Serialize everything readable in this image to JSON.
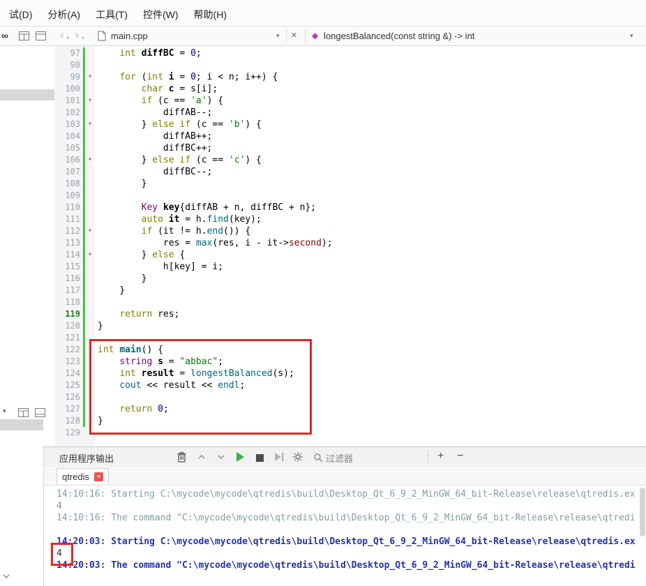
{
  "menubar": {
    "items": [
      "试(D)",
      "分析(A)",
      "工具(T)",
      "控件(W)",
      "帮助(H)"
    ]
  },
  "toolbar": {
    "file_tab": "main.cpp",
    "symbol": "longestBalanced(const string &) -> int"
  },
  "editor": {
    "lines": [
      {
        "n": 97,
        "bar": 1,
        "seg": [
          {
            "t": "    "
          },
          {
            "t": "int",
            "s": "kw"
          },
          {
            "t": " "
          },
          {
            "t": "diffBC",
            "s": "decl"
          },
          {
            "t": " = "
          },
          {
            "t": "0",
            "s": "num"
          },
          {
            "t": ";"
          }
        ]
      },
      {
        "n": 98,
        "bar": 1,
        "seg": []
      },
      {
        "n": 99,
        "bar": 1,
        "fold": 1,
        "seg": [
          {
            "t": "    "
          },
          {
            "t": "for",
            "s": "kw"
          },
          {
            "t": " ("
          },
          {
            "t": "int",
            "s": "kw"
          },
          {
            "t": " "
          },
          {
            "t": "i",
            "s": "decl"
          },
          {
            "t": " = "
          },
          {
            "t": "0",
            "s": "num"
          },
          {
            "t": "; i < n; i++) {"
          }
        ]
      },
      {
        "n": 100,
        "bar": 1,
        "seg": [
          {
            "t": "        "
          },
          {
            "t": "char",
            "s": "kw"
          },
          {
            "t": " "
          },
          {
            "t": "c",
            "s": "decl"
          },
          {
            "t": " = s[i];"
          }
        ]
      },
      {
        "n": 101,
        "bar": 1,
        "fold": 1,
        "seg": [
          {
            "t": "        "
          },
          {
            "t": "if",
            "s": "kw"
          },
          {
            "t": " (c == "
          },
          {
            "t": "'a'",
            "s": "str"
          },
          {
            "t": ") {"
          }
        ]
      },
      {
        "n": 102,
        "bar": 1,
        "seg": [
          {
            "t": "            diffAB--;"
          }
        ]
      },
      {
        "n": 103,
        "bar": 1,
        "fold": 1,
        "seg": [
          {
            "t": "        } "
          },
          {
            "t": "else",
            "s": "kw"
          },
          {
            "t": " "
          },
          {
            "t": "if",
            "s": "kw"
          },
          {
            "t": " (c == "
          },
          {
            "t": "'b'",
            "s": "str"
          },
          {
            "t": ") {"
          }
        ]
      },
      {
        "n": 104,
        "bar": 1,
        "seg": [
          {
            "t": "            diffAB++;"
          }
        ]
      },
      {
        "n": 105,
        "bar": 1,
        "seg": [
          {
            "t": "            diffBC++;"
          }
        ]
      },
      {
        "n": 106,
        "bar": 1,
        "fold": 1,
        "seg": [
          {
            "t": "        } "
          },
          {
            "t": "else",
            "s": "kw"
          },
          {
            "t": " "
          },
          {
            "t": "if",
            "s": "kw"
          },
          {
            "t": " (c == "
          },
          {
            "t": "'c'",
            "s": "str"
          },
          {
            "t": ") {"
          }
        ]
      },
      {
        "n": 107,
        "bar": 1,
        "seg": [
          {
            "t": "            diffBC--;"
          }
        ]
      },
      {
        "n": 108,
        "bar": 1,
        "seg": [
          {
            "t": "        }"
          }
        ]
      },
      {
        "n": 109,
        "bar": 1,
        "seg": []
      },
      {
        "n": 110,
        "bar": 1,
        "seg": [
          {
            "t": "        "
          },
          {
            "t": "Key",
            "s": "type"
          },
          {
            "t": " "
          },
          {
            "t": "key",
            "s": "decl"
          },
          {
            "t": "{diffAB + n, diffBC + n};"
          }
        ]
      },
      {
        "n": 111,
        "bar": 1,
        "seg": [
          {
            "t": "        "
          },
          {
            "t": "auto",
            "s": "kw"
          },
          {
            "t": " "
          },
          {
            "t": "it",
            "s": "decl"
          },
          {
            "t": " = h."
          },
          {
            "t": "find",
            "s": "func"
          },
          {
            "t": "(key);"
          }
        ]
      },
      {
        "n": 112,
        "bar": 1,
        "fold": 1,
        "seg": [
          {
            "t": "        "
          },
          {
            "t": "if",
            "s": "kw"
          },
          {
            "t": " (it != h."
          },
          {
            "t": "end",
            "s": "func"
          },
          {
            "t": "()) {"
          }
        ]
      },
      {
        "n": 113,
        "bar": 1,
        "seg": [
          {
            "t": "            res = "
          },
          {
            "t": "max",
            "s": "func"
          },
          {
            "t": "(res, i - it->"
          },
          {
            "t": "second",
            "s": "field"
          },
          {
            "t": ");"
          }
        ]
      },
      {
        "n": 114,
        "bar": 1,
        "fold": 1,
        "seg": [
          {
            "t": "        } "
          },
          {
            "t": "else",
            "s": "kw"
          },
          {
            "t": " {"
          }
        ]
      },
      {
        "n": 115,
        "bar": 1,
        "seg": [
          {
            "t": "            h[key] = i;"
          }
        ]
      },
      {
        "n": 116,
        "bar": 1,
        "seg": [
          {
            "t": "        }"
          }
        ]
      },
      {
        "n": 117,
        "bar": 1,
        "seg": [
          {
            "t": "    }"
          }
        ]
      },
      {
        "n": 118,
        "bar": 1,
        "seg": []
      },
      {
        "n": 119,
        "bar": 1,
        "hl": 1,
        "seg": [
          {
            "t": "    "
          },
          {
            "t": "return",
            "s": "kw"
          },
          {
            "t": " res;"
          }
        ]
      },
      {
        "n": 120,
        "bar": 1,
        "seg": [
          {
            "t": "}"
          }
        ]
      },
      {
        "n": 121,
        "bar": 1,
        "seg": []
      },
      {
        "n": 122,
        "bar": 1,
        "fold": 1,
        "seg": [
          {
            "t": "int",
            "s": "kw"
          },
          {
            "t": " "
          },
          {
            "t": "main",
            "s": "declf"
          },
          {
            "t": "() {"
          }
        ]
      },
      {
        "n": 123,
        "bar": 1,
        "seg": [
          {
            "t": "    "
          },
          {
            "t": "string",
            "s": "type"
          },
          {
            "t": " "
          },
          {
            "t": "s",
            "s": "decl"
          },
          {
            "t": " = "
          },
          {
            "t": "\"abbac\"",
            "s": "str"
          },
          {
            "t": ";"
          }
        ]
      },
      {
        "n": 124,
        "bar": 1,
        "seg": [
          {
            "t": "    "
          },
          {
            "t": "int",
            "s": "kw"
          },
          {
            "t": " "
          },
          {
            "t": "result",
            "s": "decl"
          },
          {
            "t": " = "
          },
          {
            "t": "longestBalanced",
            "s": "func"
          },
          {
            "t": "(s);"
          }
        ]
      },
      {
        "n": 125,
        "bar": 1,
        "seg": [
          {
            "t": "    "
          },
          {
            "t": "cout",
            "s": "func"
          },
          {
            "t": " << result << "
          },
          {
            "t": "endl",
            "s": "func"
          },
          {
            "t": ";"
          }
        ]
      },
      {
        "n": 126,
        "bar": 1,
        "seg": []
      },
      {
        "n": 127,
        "bar": 1,
        "seg": [
          {
            "t": "    "
          },
          {
            "t": "return",
            "s": "kw"
          },
          {
            "t": " "
          },
          {
            "t": "0",
            "s": "num"
          },
          {
            "t": ";"
          }
        ]
      },
      {
        "n": 128,
        "bar": 1,
        "seg": [
          {
            "t": "}"
          }
        ]
      },
      {
        "n": 129,
        "seg": []
      }
    ]
  },
  "output": {
    "title": "应用程序输出",
    "filter_label": "过滤器",
    "tab_label": "qtredis",
    "add_button": "+",
    "remove_button": "−",
    "console": [
      {
        "style": "old_msg",
        "text": "14:10:16: Starting C:\\mycode\\mycode\\qtredis\\build\\Desktop_Qt_6_9_2_MinGW_64_bit-Release\\release\\qtredis.ex"
      },
      {
        "style": "old_out",
        "text": "4"
      },
      {
        "style": "old_msg",
        "text": "14:10:16: The command \"C:\\mycode\\mycode\\qtredis\\build\\Desktop_Qt_6_9_2_MinGW_64_bit-Release\\release\\qtredi"
      },
      {
        "style": "old_out",
        "text": ""
      },
      {
        "style": "new_msg",
        "text": "14:20:03: Starting C:\\mycode\\mycode\\qtredis\\build\\Desktop_Qt_6_9_2_MinGW_64_bit-Release\\release\\qtredis.ex"
      },
      {
        "style": "new_out",
        "text": "4"
      },
      {
        "style": "new_msg",
        "text": "14:20:03: The command \"C:\\mycode\\mycode\\qtredis\\build\\Desktop_Qt_6_9_2_MinGW_64_bit-Release\\release\\qtredi"
      }
    ]
  },
  "colors": {
    "annotation_red": "#e22626",
    "change_bar_green": "#44c144",
    "run_green": "#3fae49",
    "tab_close_red": "#ef5350",
    "symbol_diamond_purple": "#b13fb1",
    "keyword": "#808000",
    "string": "#008000",
    "number": "#000080",
    "type": "#800080",
    "function": "#00677c",
    "field": "#800000"
  }
}
